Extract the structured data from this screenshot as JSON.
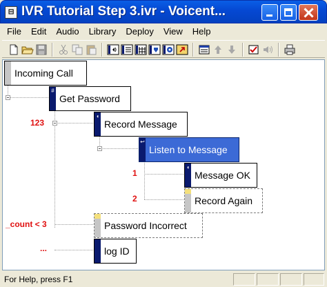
{
  "window": {
    "title": "IVR Tutorial Step 3.ivr - Voicent...",
    "app_icon_glyph": "⊟"
  },
  "menu": [
    "File",
    "Edit",
    "Audio",
    "Library",
    "Deploy",
    "View",
    "Help"
  ],
  "toolbar": {
    "icons": [
      "new-file-icon",
      "open-folder-icon",
      "save-icon",
      "cut-icon",
      "copy-icon",
      "paste-icon",
      "prompt-node-icon",
      "menu-node-icon",
      "grid-node-icon",
      "transfer-node-icon",
      "record-node-icon",
      "goto-node-icon",
      "properties-icon",
      "move-up-icon",
      "move-down-icon",
      "test-icon",
      "speaker-icon",
      "print-icon"
    ]
  },
  "tree": {
    "nodes": {
      "incoming_call": "Incoming Call",
      "get_password": "Get Password",
      "record_message": "Record Message",
      "listen_to_message": "Listen to Message",
      "message_ok": "Message OK",
      "record_again": "Record Again",
      "password_incorrect": "Password Incorrect",
      "log_id": "log ID"
    },
    "branch_labels": {
      "get_password_123": "123",
      "listen_1": "1",
      "listen_2": "2",
      "count_lt_3": "_count < 3",
      "else": "..."
    },
    "strip_glyphs": {
      "get_password": "#",
      "record_message": "◖",
      "listen_to_message": "↩",
      "message_ok": "◖"
    },
    "selected": "listen_to_message"
  },
  "status": {
    "text": "For Help, press F1"
  },
  "colors": {
    "title_bar": "#0548d2",
    "selection": "#3c6ad6",
    "branch_label": "#e01010",
    "navy_strip": "#0a1a6e",
    "hint_yellow": "#f4e07c"
  }
}
